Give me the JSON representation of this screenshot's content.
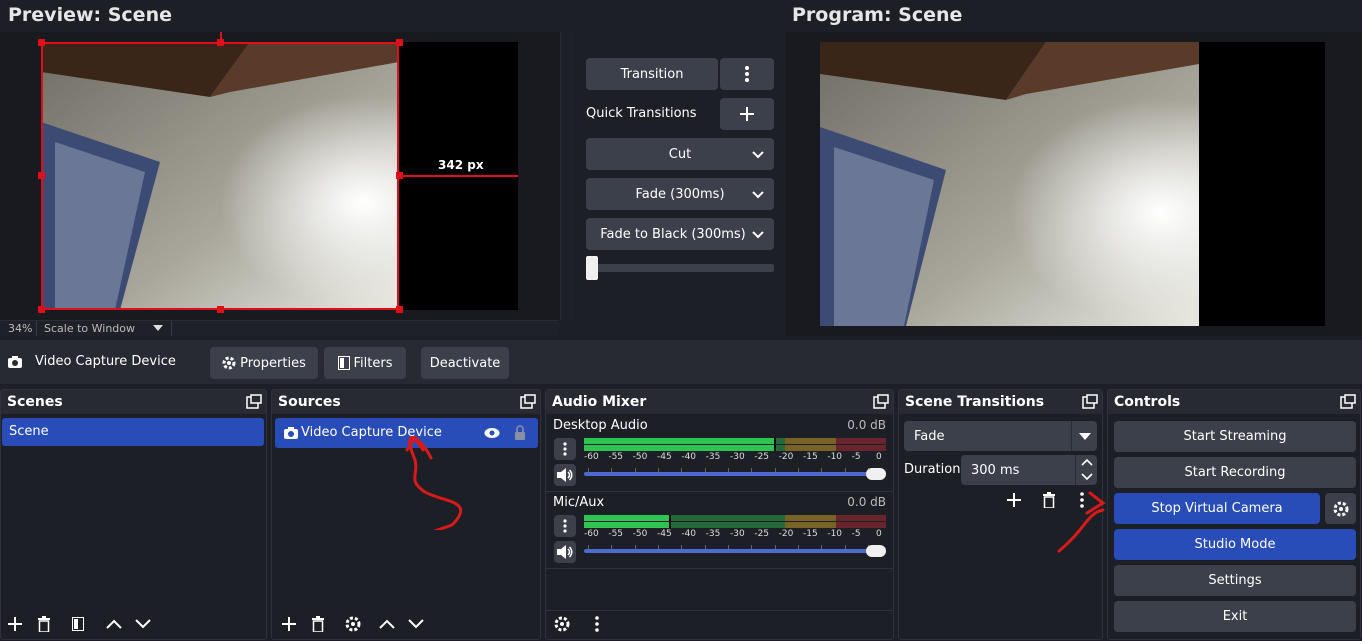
{
  "preview": {
    "title": "Preview: Scene",
    "measure_label": "342 px",
    "zoom": "34%",
    "scale_mode": "Scale to Window"
  },
  "program": {
    "title": "Program: Scene"
  },
  "transition_panel": {
    "transition_label": "Transition",
    "quick_transitions_label": "Quick Transitions",
    "options": [
      "Cut",
      "Fade (300ms)",
      "Fade to Black (300ms)"
    ],
    "t_bar_value": 0
  },
  "source_toolbar": {
    "source_name": "Video Capture Device",
    "properties_label": "Properties",
    "filters_label": "Filters",
    "deactivate_label": "Deactivate"
  },
  "scenes": {
    "title": "Scenes",
    "items": [
      "Scene"
    ]
  },
  "sources": {
    "title": "Sources",
    "items": [
      "Video Capture Device"
    ]
  },
  "audio_mixer": {
    "title": "Audio Mixer",
    "ticks": [
      "-60",
      "-55",
      "-50",
      "-45",
      "-40",
      "-35",
      "-30",
      "-25",
      "-20",
      "-15",
      "-10",
      "-5",
      "0"
    ],
    "channels": [
      {
        "name": "Desktop Audio",
        "db": "0.0 dB",
        "level": 0.63,
        "volume": 1.0
      },
      {
        "name": "Mic/Aux",
        "db": "0.0 dB",
        "level": 0.28,
        "volume": 1.0
      }
    ]
  },
  "scene_transitions": {
    "title": "Scene Transitions",
    "selected": "Fade",
    "duration_label": "Duration",
    "duration_value": "300 ms"
  },
  "controls": {
    "title": "Controls",
    "start_streaming": "Start Streaming",
    "start_recording": "Start Recording",
    "stop_virtual_camera": "Stop Virtual Camera",
    "studio_mode": "Studio Mode",
    "settings": "Settings",
    "exit": "Exit"
  },
  "colors": {
    "accent_blue": "#284cb8",
    "selection_red": "#e0101a",
    "annotation_red": "#d81a1a",
    "meter_green": "#2fc452",
    "meter_yellow": "#e8b327",
    "meter_red": "#c92a3a"
  },
  "icons": [
    "camera-icon",
    "gear-icon",
    "filter-icon",
    "undock-icon",
    "plus-icon",
    "trash-icon",
    "chevron-up-icon",
    "chevron-down-icon",
    "eye-icon",
    "lock-icon",
    "kebab-icon",
    "speaker-icon"
  ]
}
